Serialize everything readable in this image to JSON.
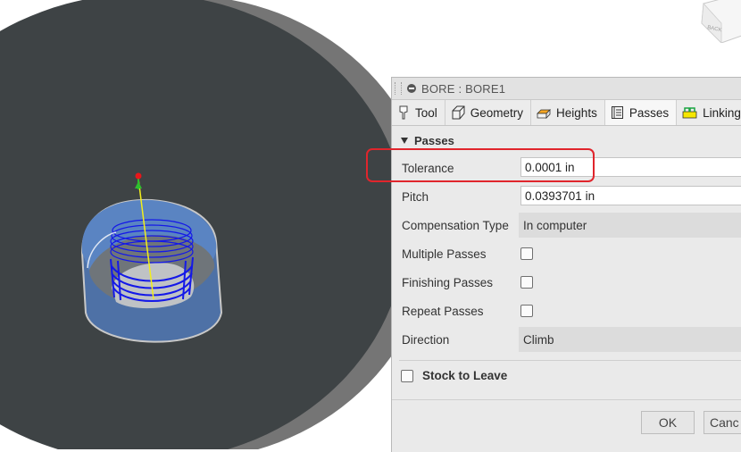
{
  "viewcube": {
    "face_label": "BACK"
  },
  "dialog": {
    "title": "BORE : BORE1",
    "tabs": [
      {
        "label": "Tool",
        "icon": "tool-icon"
      },
      {
        "label": "Geometry",
        "icon": "geometry-icon"
      },
      {
        "label": "Heights",
        "icon": "heights-icon"
      },
      {
        "label": "Passes",
        "icon": "passes-icon",
        "active": true
      },
      {
        "label": "Linking",
        "icon": "linking-icon"
      }
    ],
    "section_title": "Passes",
    "fields": {
      "tolerance": {
        "label": "Tolerance",
        "value": "0.0001 in"
      },
      "pitch": {
        "label": "Pitch",
        "value": "0.0393701 in"
      },
      "compensation": {
        "label": "Compensation Type",
        "value": "In computer"
      },
      "multiple_passes": {
        "label": "Multiple Passes",
        "checked": false
      },
      "finishing_passes": {
        "label": "Finishing Passes",
        "checked": false
      },
      "repeat_passes": {
        "label": "Repeat Passes",
        "checked": false
      },
      "direction": {
        "label": "Direction",
        "value": "Climb"
      }
    },
    "stock_to_leave": {
      "label": "Stock to Leave",
      "checked": false
    },
    "buttons": {
      "ok": "OK",
      "cancel": "Canc"
    }
  },
  "colors": {
    "background": "#ffffff",
    "stock_disc": "#3e4345",
    "part_shadow": "#757575",
    "part_face": "#5a82bc",
    "toolpath": "#1418e8",
    "highlight": "#e0252c"
  }
}
